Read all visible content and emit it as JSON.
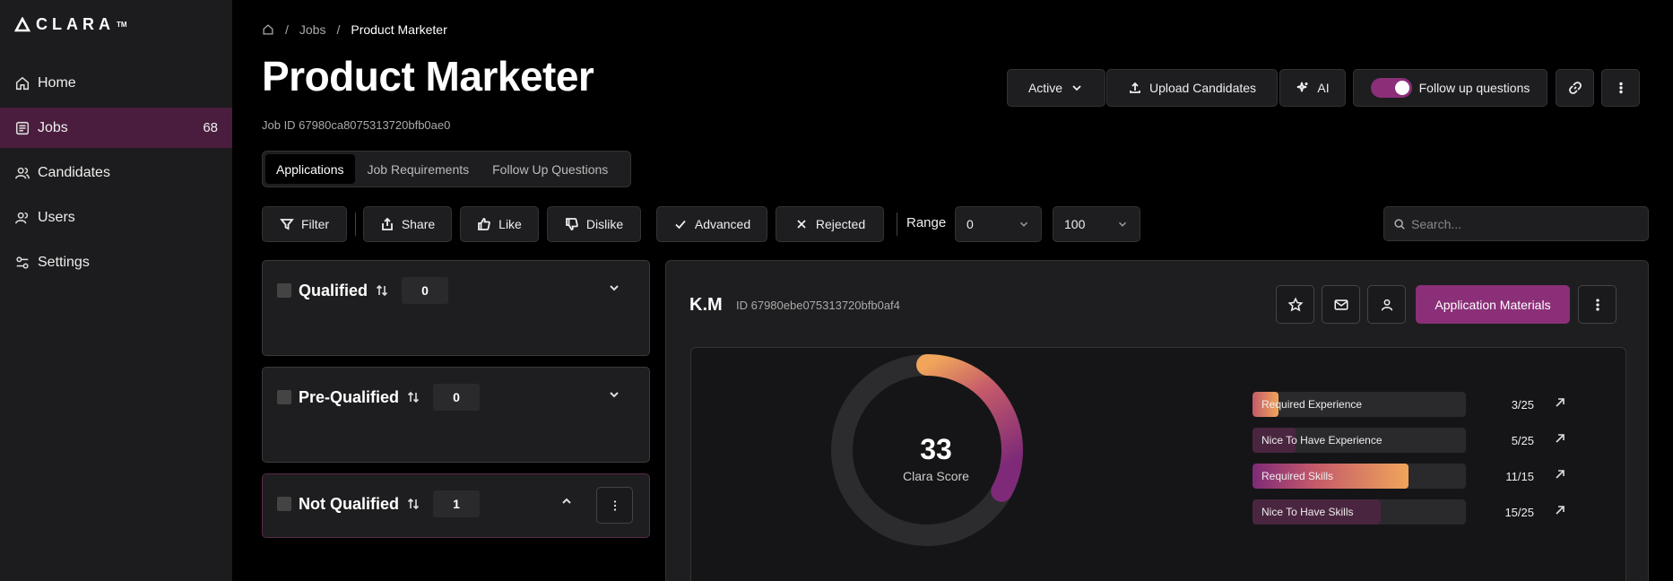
{
  "brand": {
    "logo": "CLARA",
    "tm": "TM"
  },
  "sidebar": {
    "items": [
      {
        "label": "Home",
        "icon": "home-icon"
      },
      {
        "label": "Jobs",
        "icon": "jobs-icon",
        "count": "68",
        "active": true
      },
      {
        "label": "Candidates",
        "icon": "candidates-icon"
      },
      {
        "label": "Users",
        "icon": "users-icon"
      },
      {
        "label": "Settings",
        "icon": "settings-icon"
      }
    ]
  },
  "breadcrumb": {
    "items": [
      "Jobs",
      "Product Marketer"
    ]
  },
  "header": {
    "title": "Product Marketer",
    "job_id": "Job ID 67980ca8075313720bfb0ae0",
    "status": "Active",
    "upload": "Upload Candidates",
    "ai": "AI",
    "followup": "Follow up questions",
    "followup_on": true
  },
  "tabs": [
    {
      "label": "Applications",
      "active": true
    },
    {
      "label": "Job Requirements"
    },
    {
      "label": "Follow Up Questions"
    }
  ],
  "toolbar": {
    "filter": "Filter",
    "share": "Share",
    "like": "Like",
    "dislike": "Dislike",
    "advanced": "Advanced",
    "rejected": "Rejected",
    "range_label": "Range",
    "range_min": "0",
    "range_max": "100",
    "search_placeholder": "Search..."
  },
  "groups": [
    {
      "name": "Qualified",
      "count": "0",
      "expanded": false
    },
    {
      "name": "Pre-Qualified",
      "count": "0",
      "expanded": false
    },
    {
      "name": "Not Qualified",
      "count": "1",
      "expanded": true
    }
  ],
  "candidate": {
    "initials": "K.M",
    "id": "ID 67980ebe075313720bfb0af4",
    "materials": "Application Materials",
    "score": "33",
    "score_label": "Clara Score",
    "score_value": 33,
    "criteria": [
      {
        "label": "Required Experience",
        "value": "3/25",
        "fraction": 0.12
      },
      {
        "label": "Nice To Have Experience",
        "value": "5/25",
        "fraction": 0.2
      },
      {
        "label": "Required Skills",
        "value": "11/15",
        "fraction": 0.733
      },
      {
        "label": "Nice To Have Skills",
        "value": "15/25",
        "fraction": 0.6
      }
    ]
  },
  "colors": {
    "accent": "#8b2f78",
    "active_nav": "#4a1d3e",
    "gradient_start": "#f0a55a",
    "gradient_mid": "#c45a6a",
    "gradient_end": "#7e2a78"
  }
}
